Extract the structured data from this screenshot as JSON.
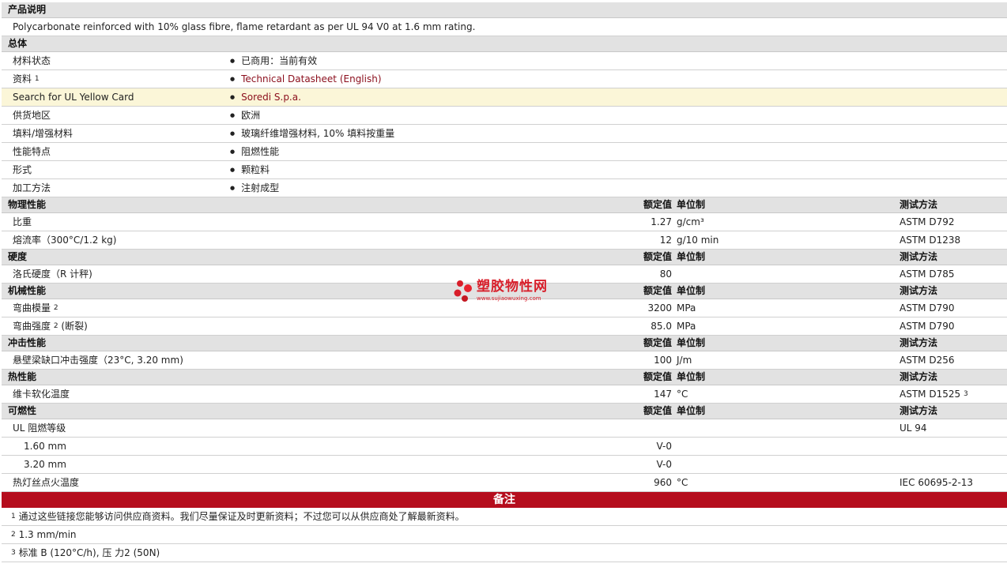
{
  "product": {
    "header": "产品说明",
    "description": "Polycarbonate reinforced with 10% glass fibre, flame retardant as per UL 94 V0 at 1.6 mm rating."
  },
  "general": {
    "header": "总体",
    "rows": [
      {
        "label": "材料状态",
        "value": "已商用：当前有效"
      },
      {
        "label": "资料",
        "sup": "1",
        "value": "Technical Datasheet (English)"
      },
      {
        "label": "Search for UL Yellow Card",
        "value": "Soredi S.p.a."
      },
      {
        "label": "供货地区",
        "value": "欧洲"
      },
      {
        "label": "填料/增强材料",
        "value": "玻璃纤维增强材料, 10% 填料按重量"
      },
      {
        "label": "性能特点",
        "value": "阻燃性能"
      },
      {
        "label": "形式",
        "value": "颗粒料"
      },
      {
        "label": "加工方法",
        "value": "注射成型"
      }
    ]
  },
  "col": {
    "value": "额定值",
    "unit": "单位制",
    "method": "测试方法"
  },
  "physical": {
    "header": "物理性能",
    "rows": [
      {
        "label": "比重",
        "value": "1.27",
        "unit": "g/cm³",
        "method": "ASTM D792"
      },
      {
        "label": "熔流率（300°C/1.2 kg)",
        "value": "12",
        "unit": "g/10 min",
        "method": "ASTM D1238"
      }
    ]
  },
  "hardness": {
    "header": "硬度",
    "rows": [
      {
        "label": "洛氏硬度（R 计秤)",
        "value": "80",
        "unit": "",
        "method": "ASTM D785"
      }
    ]
  },
  "mechanical": {
    "header": "机械性能",
    "rows": [
      {
        "label": "弯曲模量",
        "sup": "2",
        "value": "3200",
        "unit": "MPa",
        "method": "ASTM D790"
      },
      {
        "label": "弯曲强度",
        "sup": "2",
        "suffix": "(断裂)",
        "value": "85.0",
        "unit": "MPa",
        "method": "ASTM D790"
      }
    ]
  },
  "impact": {
    "header": "冲击性能",
    "rows": [
      {
        "label": "悬壁梁缺口冲击强度（23°C, 3.20 mm)",
        "value": "100",
        "unit": "J/m",
        "method": "ASTM D256"
      }
    ]
  },
  "thermal": {
    "header": "热性能",
    "rows": [
      {
        "label": "维卡软化温度",
        "value": "147",
        "unit": "°C",
        "method": "ASTM D1525",
        "method_sup": "3"
      }
    ]
  },
  "flammability": {
    "header": "可燃性",
    "rows": [
      {
        "label": "UL 阻燃等级",
        "value": "",
        "unit": "",
        "method": "UL 94"
      },
      {
        "label": "1.60 mm",
        "value": "V-0",
        "unit": "",
        "method": ""
      },
      {
        "label": "3.20 mm",
        "value": "V-0",
        "unit": "",
        "method": ""
      },
      {
        "label": "热灯丝点火温度",
        "value": "960",
        "unit": "°C",
        "method": "IEC 60695-2-13"
      }
    ]
  },
  "notes": {
    "header": "备注",
    "items": [
      {
        "num": "1",
        "text": "通过这些链接您能够访问供应商资料。我们尽量保证及时更新资料；不过您可以从供应商处了解最新资料。"
      },
      {
        "num": "2",
        "text": "1.3 mm/min"
      },
      {
        "num": "3",
        "text": "标准 B (120°C/h), 压 力2 (50N)"
      }
    ]
  },
  "watermark": {
    "name": "塑胶物性网",
    "url": "www.sujiaowuxing.com"
  },
  "colors": {
    "note_header_bg": "#b50d1d",
    "link": "#8b0e1c",
    "watermark": "#d81e2a",
    "highlight_row": "#fbf6d8"
  }
}
